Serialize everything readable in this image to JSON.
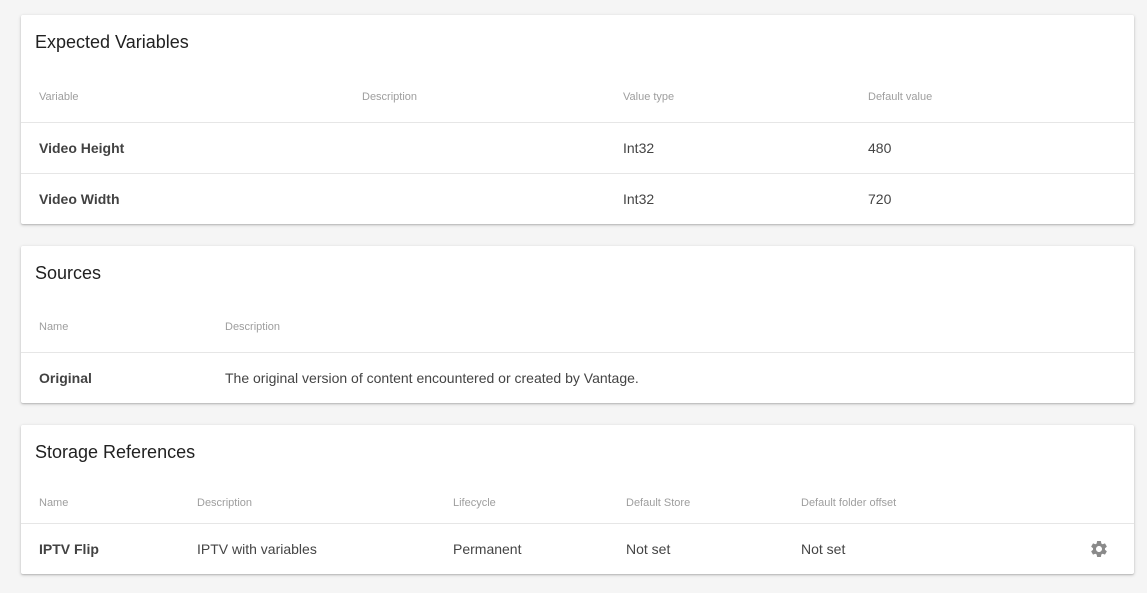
{
  "expected_variables": {
    "title": "Expected Variables",
    "columns": [
      "Variable",
      "Description",
      "Value type",
      "Default value"
    ],
    "rows": [
      {
        "variable": "Video Height",
        "description": "",
        "value_type": "Int32",
        "default_value": "480"
      },
      {
        "variable": "Video Width",
        "description": "",
        "value_type": "Int32",
        "default_value": "720"
      }
    ]
  },
  "sources": {
    "title": "Sources",
    "columns": [
      "Name",
      "Description"
    ],
    "rows": [
      {
        "name": "Original",
        "description": "The original version of content encountered or created by Vantage."
      }
    ]
  },
  "storage_references": {
    "title": "Storage References",
    "columns": [
      "Name",
      "Description",
      "Lifecycle",
      "Default Store",
      "Default folder offset"
    ],
    "rows": [
      {
        "name": "IPTV Flip",
        "description": "IPTV with variables",
        "lifecycle": "Permanent",
        "default_store": "Not set",
        "default_folder_offset": "Not set",
        "action_icon": "gear-icon"
      }
    ]
  },
  "colors": {
    "background": "#f5f5f5",
    "card": "#ffffff",
    "header_text": "#9e9e9e",
    "icon": "#8a8a8a"
  }
}
